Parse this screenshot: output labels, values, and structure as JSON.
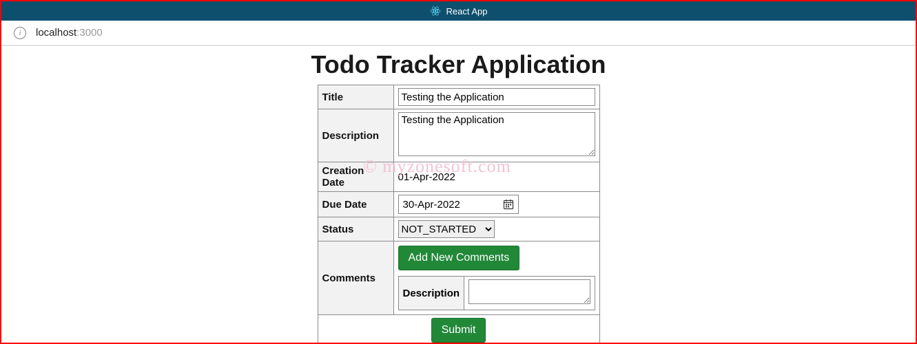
{
  "browser": {
    "tab_title": "React App",
    "url_host": "localhost",
    "url_port": ":3000"
  },
  "heading": "Todo Tracker Application",
  "watermark": "© myzonesoft.com",
  "form": {
    "labels": {
      "title": "Title",
      "description": "Description",
      "creation_date": "Creation Date",
      "due_date": "Due Date",
      "status": "Status",
      "comments": "Comments",
      "inner_description": "Description"
    },
    "title_value": "Testing the Application",
    "description_value": "Testing the Application",
    "creation_date_value": "01-Apr-2022",
    "due_date_value": "30-Apr-2022",
    "status_selected": "NOT_STARTED",
    "status_options": [
      "NOT_STARTED"
    ],
    "add_comments_label": "Add New Comments",
    "inner_description_value": "",
    "submit_label": "Submit"
  }
}
